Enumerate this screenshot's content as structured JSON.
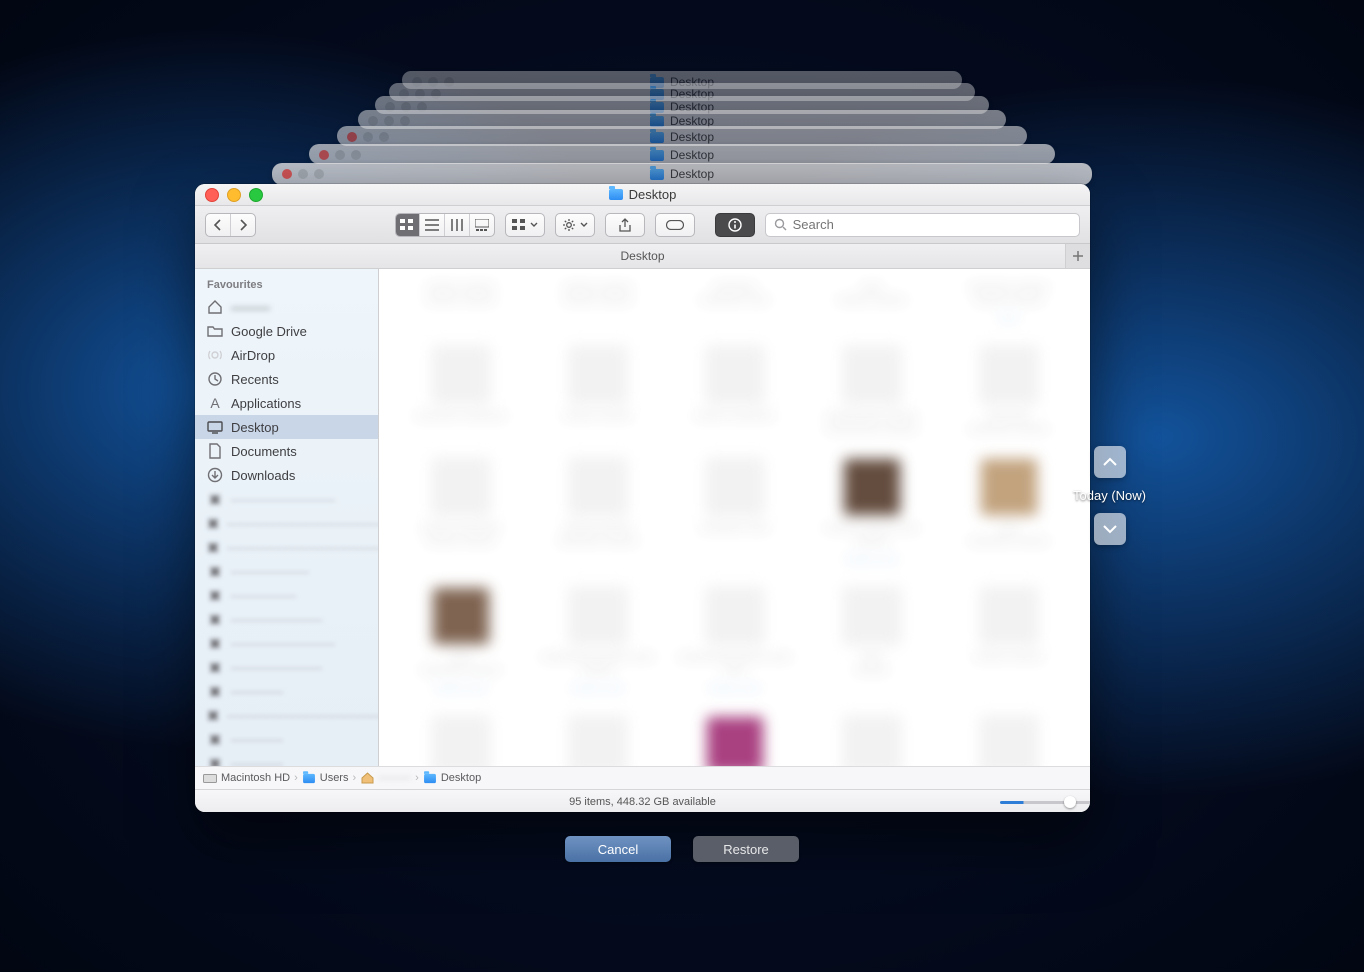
{
  "window": {
    "title": "Desktop",
    "tab_label": "Desktop"
  },
  "ghost_title": "Desktop",
  "toolbar": {
    "search_placeholder": "Search"
  },
  "sidebar": {
    "header": "Favourites",
    "items": [
      {
        "label": "",
        "icon": "home",
        "blurred": true
      },
      {
        "label": "Google Drive",
        "icon": "folder"
      },
      {
        "label": "AirDrop",
        "icon": "airdrop",
        "dim": true
      },
      {
        "label": "Recents",
        "icon": "recents"
      },
      {
        "label": "Applications",
        "icon": "apps"
      },
      {
        "label": "Desktop",
        "icon": "desktop",
        "selected": true
      },
      {
        "label": "Documents",
        "icon": "docs"
      },
      {
        "label": "Downloads",
        "icon": "downloads"
      }
    ]
  },
  "path": {
    "disk": "Macintosh HD",
    "users": "Users",
    "leaf": "Desktop"
  },
  "status": {
    "text": "95 items, 448.32 GB available"
  },
  "timeline": {
    "label": "Today (Now)"
  },
  "actions": {
    "cancel": "Cancel",
    "restore": "Restore"
  }
}
